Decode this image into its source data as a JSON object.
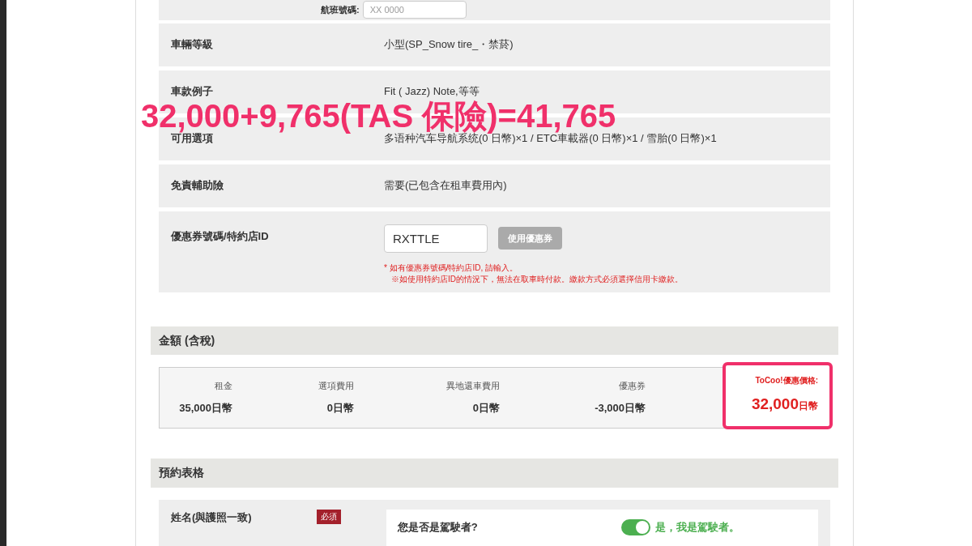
{
  "top_row": {
    "label": "航班號碼:",
    "placeholder": "XX 0000"
  },
  "info_rows": [
    {
      "label": "車輛等級",
      "value": "小型(SP_Snow tire_・禁菸)"
    },
    {
      "label": "車款例子",
      "value": "Fit ( Jazz) Note,等等"
    },
    {
      "label": "可用選項",
      "value": "多语种汽车导航系统(0 日幣)×1 / ETC車載器(0 日幣)×1 / 雪胎(0 日幣)×1"
    },
    {
      "label": "免責輔助險",
      "value": "需要(已包含在租車費用內)"
    }
  ],
  "coupon": {
    "label": "優惠券號碼/特約店ID",
    "value": "RXTTLE",
    "button": "使用優惠券",
    "notes": [
      "* 如有優惠券號碼/特約店ID, 請輸入。",
      "※如使用特約店ID的情況下，無法在取車時付款。繳款方式必須選擇信用卡繳款。"
    ]
  },
  "amount": {
    "title": "金額 (含稅)",
    "items": [
      {
        "label": "租金",
        "value": "35,000日幣"
      },
      {
        "label": "選項費用",
        "value": "0日幣"
      },
      {
        "label": "異地還車費用",
        "value": "0日幣"
      },
      {
        "label": "優惠券",
        "value": "-3,000日幣"
      }
    ],
    "total": {
      "label": "ToCoo!優惠價格:",
      "number": "32,000",
      "unit": "日幣"
    }
  },
  "reservation": {
    "title": "預約表格",
    "field_label": "姓名(與護照一致)",
    "badge": "必須",
    "question": "您是否是駕駛者?",
    "toggle_on": true,
    "toggle_label": "是，我是駕駛者。"
  },
  "annotation": "32,000+9,765(TAS 保險)=41,765"
}
